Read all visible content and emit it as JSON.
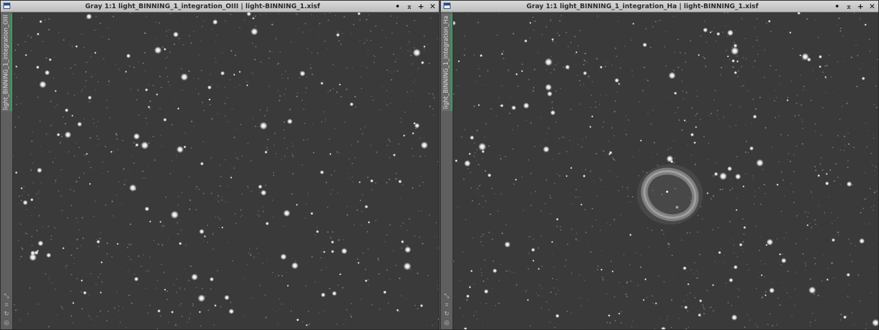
{
  "windows": [
    {
      "id": "oiii",
      "title": "Gray 1:1 light_BINNING_1_integration_OIII | light-BINNING_1.xisf",
      "tab_label": "light_BINNING_1_integration_OIII"
    },
    {
      "id": "ha",
      "title": "Gray 1:1 light_BINNING_1_integration_Ha | light-BINNING_1.xisf",
      "tab_label": "light_BINNING_1_integration_Ha"
    }
  ],
  "controls": {
    "shade_glyph": "•",
    "minimize_glyph": "⌅",
    "maximize_glyph": "+",
    "close_glyph": "✕"
  },
  "colors": {
    "sky": "#3a3a3a",
    "tab_accent": "#2fa35b",
    "titlebar": "#c9c9c9"
  },
  "icons": [
    "window-icon",
    "shade-icon",
    "minimize-icon",
    "maximize-icon",
    "close-icon",
    "resize-icon",
    "fit-icon",
    "link-icon",
    "lock-icon"
  ]
}
